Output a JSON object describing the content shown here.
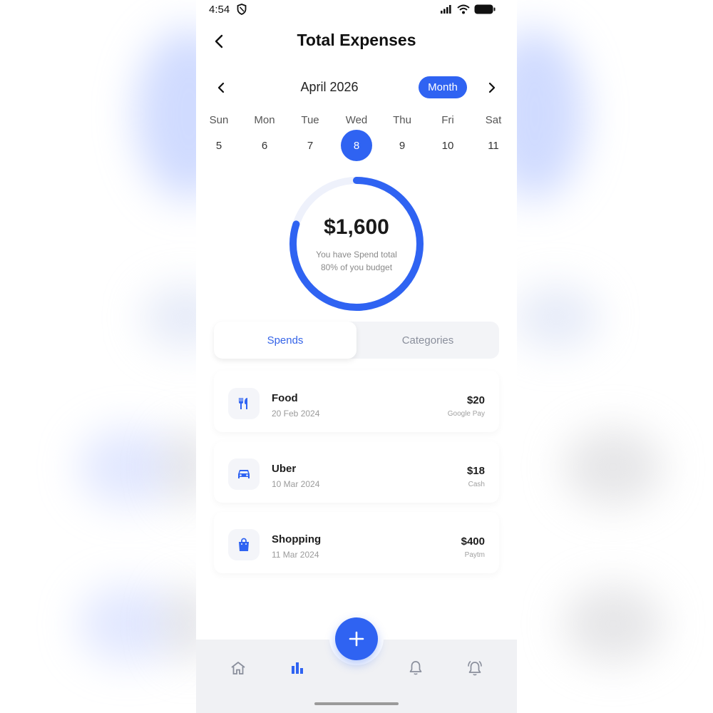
{
  "status_bar": {
    "time": "4:54"
  },
  "header": {
    "title": "Total Expenses"
  },
  "calendar": {
    "month_label": "April 2026",
    "period_button": "Month",
    "days": [
      {
        "name": "Sun",
        "number": "5"
      },
      {
        "name": "Mon",
        "number": "6"
      },
      {
        "name": "Tue",
        "number": "7"
      },
      {
        "name": "Wed",
        "number": "8"
      },
      {
        "name": "Thu",
        "number": "9"
      },
      {
        "name": "Fri",
        "number": "10"
      },
      {
        "name": "Sat",
        "number": "11"
      }
    ],
    "selected_day": "8"
  },
  "summary": {
    "amount": "$1,600",
    "caption": "You have Spend total 80% of you budget",
    "budget_used_fraction": 0.8
  },
  "tabs": {
    "spends": "Spends",
    "categories": "Categories",
    "active": "Spends"
  },
  "transactions": [
    {
      "name": "Food",
      "date": "20 Feb 2024",
      "amount": "$20",
      "method": "Google Pay",
      "icon": "fork-knife-icon"
    },
    {
      "name": "Uber",
      "date": "10 Mar 2024",
      "amount": "$18",
      "method": "Cash",
      "icon": "car-icon"
    },
    {
      "name": "Shopping",
      "date": "11 Mar 2024",
      "amount": "$400",
      "method": "Paytm",
      "icon": "shopping-bag-icon"
    }
  ],
  "colors": {
    "accent": "#2f63f2",
    "ring_track": "#eef1fb"
  },
  "bottom_nav": {
    "active": "stats"
  }
}
